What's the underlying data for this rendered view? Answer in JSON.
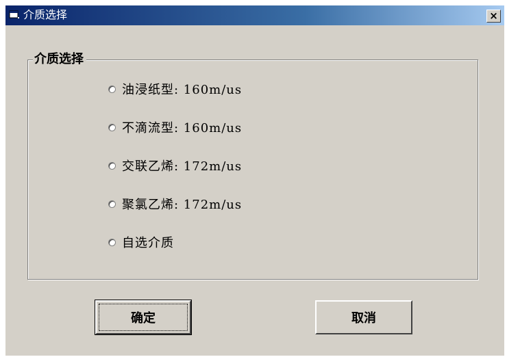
{
  "window": {
    "title": "介质选择",
    "close_label": "×"
  },
  "group": {
    "title": "介质选择"
  },
  "options": [
    {
      "label": "油浸纸型: 160m/us"
    },
    {
      "label": "不滴流型: 160m/us"
    },
    {
      "label": "交联乙烯: 172m/us"
    },
    {
      "label": "聚氯乙烯: 172m/us"
    },
    {
      "label": "自选介质"
    }
  ],
  "buttons": {
    "ok_label": "确定",
    "cancel_label": "取消"
  },
  "colors": {
    "titlebar_start": "#0a246a",
    "titlebar_end": "#a6caf0",
    "face": "#d4d0c8"
  },
  "icons": {
    "app": "window-app-icon",
    "close": "close-icon"
  }
}
